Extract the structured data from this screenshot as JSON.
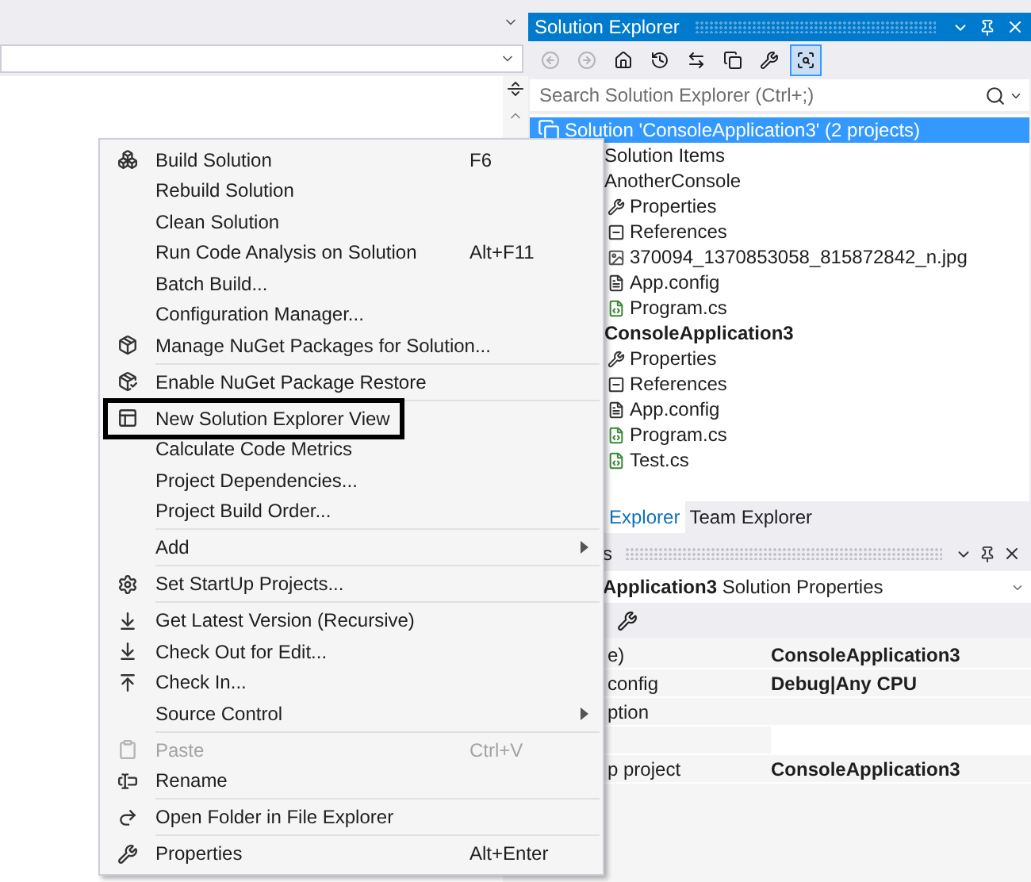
{
  "solution_explorer": {
    "title": "Solution Explorer",
    "search": {
      "placeholder": "Search Solution Explorer (Ctrl+;)"
    },
    "toolbar": [
      {
        "disabled": true,
        "selected": false
      },
      {
        "disabled": true,
        "selected": false
      },
      {
        "disabled": false,
        "selected": false
      },
      {
        "disabled": false,
        "selected": false
      },
      {
        "disabled": false,
        "selected": false
      },
      {
        "disabled": false,
        "selected": false
      },
      {
        "disabled": false,
        "selected": false
      },
      {
        "disabled": false,
        "selected": true
      }
    ],
    "tree": [
      {
        "label": "Solution 'ConsoleApplication3' (2 projects)",
        "selected": true,
        "bold": false,
        "children": [
          {
            "label": "Solution Items",
            "selected": false,
            "bold": false
          },
          {
            "label": "AnotherConsole",
            "selected": false,
            "bold": false,
            "children": [
              {
                "label": "Properties",
                "kind": "properties",
                "selected": false
              },
              {
                "label": "References",
                "kind": "references",
                "selected": false
              },
              {
                "label": "370094_1370853058_815872842_n.jpg",
                "kind": "image",
                "selected": false
              },
              {
                "label": "App.config",
                "kind": "config",
                "selected": false
              },
              {
                "label": "Program.cs",
                "kind": "csharp",
                "selected": false
              }
            ]
          },
          {
            "label": "ConsoleApplication3",
            "selected": false,
            "bold": true,
            "children": [
              {
                "label": "Properties",
                "kind": "properties",
                "selected": false
              },
              {
                "label": "References",
                "kind": "references",
                "selected": false
              },
              {
                "label": "App.config",
                "kind": "config",
                "selected": false
              },
              {
                "label": "Program.cs",
                "kind": "csharp",
                "selected": false
              },
              {
                "label": "Test.cs",
                "kind": "csharp",
                "selected": false
              }
            ]
          }
        ]
      }
    ],
    "tabs": [
      {
        "label": "Explorer",
        "selected": true
      },
      {
        "label": "Team Explorer",
        "selected": false
      }
    ]
  },
  "properties": {
    "title": "s",
    "object": "**Application3** Solution Properties",
    "rows": [
      {
        "name": "e)",
        "value": "ConsoleApplication3",
        "kind": "text"
      },
      {
        "name": "config",
        "value": "Debug|Any CPU",
        "kind": "text"
      },
      {
        "name": "ption",
        "kind": "text"
      },
      {
        "kind": "field"
      },
      {
        "name": "p project",
        "value": "ConsoleApplication3",
        "kind": "text"
      }
    ]
  },
  "context_menu": {
    "groups": [
      [
        {
          "label": "Build Solution",
          "shortcut": "F6",
          "disabled": false,
          "outlined": false,
          "submenu": false
        },
        {
          "label": "Rebuild Solution",
          "disabled": false,
          "outlined": false,
          "submenu": false
        },
        {
          "label": "Clean Solution",
          "disabled": false,
          "outlined": false,
          "submenu": false
        },
        {
          "label": "Run Code Analysis on Solution",
          "shortcut": "Alt+F11",
          "disabled": false,
          "outlined": false,
          "submenu": false
        },
        {
          "label": "Batch Build...",
          "disabled": false,
          "outlined": false,
          "submenu": false
        },
        {
          "label": "Configuration Manager...",
          "disabled": false,
          "outlined": false,
          "submenu": false
        },
        {
          "label": "Manage NuGet Packages for Solution...",
          "disabled": false,
          "outlined": false,
          "submenu": false
        }
      ],
      [
        {
          "label": "Enable NuGet Package Restore",
          "disabled": false,
          "outlined": false,
          "submenu": false
        }
      ],
      [
        {
          "label": "New Solution Explorer View",
          "disabled": false,
          "outlined": true,
          "submenu": false
        },
        {
          "label": "Calculate Code Metrics",
          "disabled": false,
          "outlined": false,
          "submenu": false
        },
        {
          "label": "Project Dependencies...",
          "disabled": false,
          "outlined": false,
          "submenu": false
        },
        {
          "label": "Project Build Order...",
          "disabled": false,
          "outlined": false,
          "submenu": false
        }
      ],
      [
        {
          "label": "Add",
          "disabled": false,
          "outlined": false,
          "submenu": true
        }
      ],
      [
        {
          "label": "Set StartUp Projects...",
          "disabled": false,
          "outlined": false,
          "submenu": false
        }
      ],
      [
        {
          "label": "Get Latest Version (Recursive)",
          "disabled": false,
          "outlined": false,
          "submenu": false
        },
        {
          "label": "Check Out for Edit...",
          "disabled": false,
          "outlined": false,
          "submenu": false
        },
        {
          "label": "Check In...",
          "disabled": false,
          "outlined": false,
          "submenu": false
        },
        {
          "label": "Source Control",
          "disabled": false,
          "outlined": false,
          "submenu": true
        }
      ],
      [
        {
          "label": "Paste",
          "shortcut": "Ctrl+V",
          "disabled": true,
          "outlined": false,
          "submenu": false
        },
        {
          "label": "Rename",
          "disabled": false,
          "outlined": false,
          "submenu": false
        }
      ],
      [
        {
          "label": "Open Folder in File Explorer",
          "disabled": false,
          "outlined": false,
          "submenu": false
        }
      ],
      [
        {
          "label": "Properties",
          "shortcut": "Alt+Enter",
          "disabled": false,
          "outlined": false,
          "submenu": false
        }
      ]
    ]
  }
}
